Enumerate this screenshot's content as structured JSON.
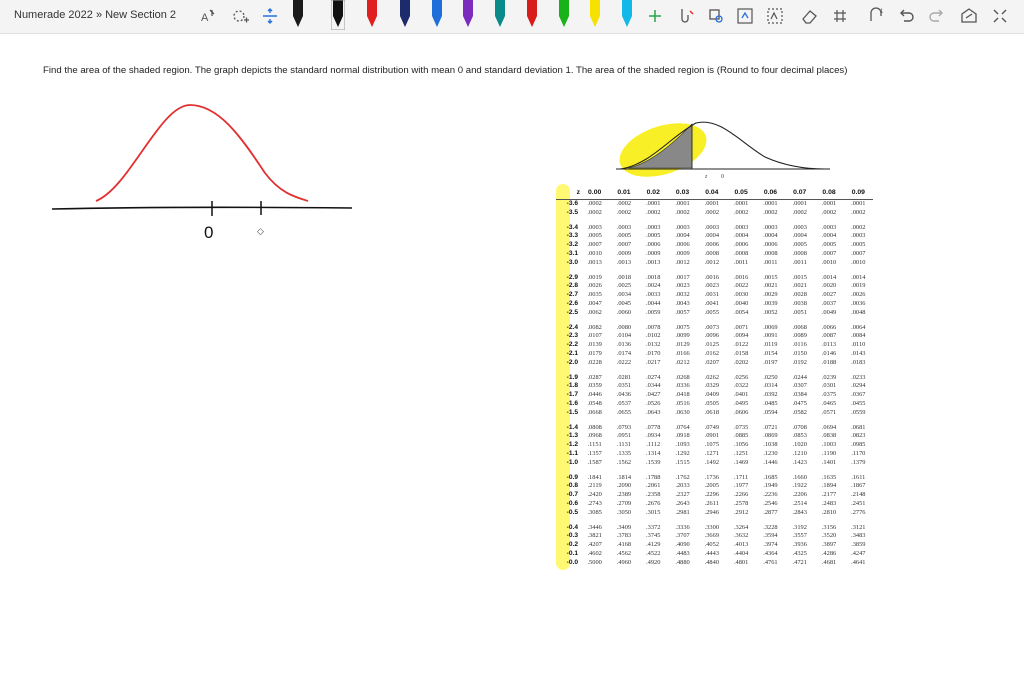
{
  "header": {
    "breadcrumb": "Numerade 2022 » New Section 2"
  },
  "toolbar": {
    "icons": [
      "lasso-select-icon",
      "add-shape-icon",
      "insert-space-icon",
      "pen-black",
      "pen-black-selected",
      "pen-red",
      "pen-navy",
      "pen-blue",
      "pen-purple",
      "pen-teal",
      "pen-red-2",
      "pen-green",
      "pen-yellow-highlighter",
      "pen-cyan",
      "add-pen-icon",
      "ink-to-shape-icon",
      "ink-to-text-icon",
      "ink-replay-icon",
      "math-icon",
      "eraser-icon",
      "ruler-icon",
      "lasso-icon",
      "undo-icon",
      "redo-icon",
      "full-screen-icon",
      "collapse-icon"
    ],
    "pen_colors": [
      "#1a1a1a",
      "#111111",
      "#e02020",
      "#1d2a6b",
      "#1e6fd9",
      "#7b2cbf",
      "#0b8a8a",
      "#d81b1b",
      "#19b219",
      "#f5e200",
      "#12b9e8"
    ]
  },
  "question": {
    "text": "Find the area of the shaded region. The graph depicts the standard normal distribution with mean 0 and standard deviation 1. The area of the shaded region is (Round to four decimal places)"
  },
  "graph": {
    "z_label": "z",
    "zero_label": "0"
  },
  "sketch": {
    "zero_label": "0"
  },
  "ztable": {
    "header": [
      "z",
      "0.00",
      "0.01",
      "0.02",
      "0.03",
      "0.04",
      "0.05",
      "0.06",
      "0.07",
      "0.08",
      "0.09"
    ],
    "groups": [
      [
        [
          "-3.6",
          ".0002",
          ".0002",
          ".0001",
          ".0001",
          ".0001",
          ".0001",
          ".0001",
          ".0001",
          ".0001",
          ".0001"
        ],
        [
          "-3.5",
          ".0002",
          ".0002",
          ".0002",
          ".0002",
          ".0002",
          ".0002",
          ".0002",
          ".0002",
          ".0002",
          ".0002"
        ]
      ],
      [
        [
          "-3.4",
          ".0003",
          ".0003",
          ".0003",
          ".0003",
          ".0003",
          ".0003",
          ".0003",
          ".0003",
          ".0003",
          ".0002"
        ],
        [
          "-3.3",
          ".0005",
          ".0005",
          ".0005",
          ".0004",
          ".0004",
          ".0004",
          ".0004",
          ".0004",
          ".0004",
          ".0003"
        ],
        [
          "-3.2",
          ".0007",
          ".0007",
          ".0006",
          ".0006",
          ".0006",
          ".0006",
          ".0006",
          ".0005",
          ".0005",
          ".0005"
        ],
        [
          "-3.1",
          ".0010",
          ".0009",
          ".0009",
          ".0009",
          ".0008",
          ".0008",
          ".0008",
          ".0008",
          ".0007",
          ".0007"
        ],
        [
          "-3.0",
          ".0013",
          ".0013",
          ".0013",
          ".0012",
          ".0012",
          ".0011",
          ".0011",
          ".0011",
          ".0010",
          ".0010"
        ]
      ],
      [
        [
          "-2.9",
          ".0019",
          ".0018",
          ".0018",
          ".0017",
          ".0016",
          ".0016",
          ".0015",
          ".0015",
          ".0014",
          ".0014"
        ],
        [
          "-2.8",
          ".0026",
          ".0025",
          ".0024",
          ".0023",
          ".0023",
          ".0022",
          ".0021",
          ".0021",
          ".0020",
          ".0019"
        ],
        [
          "-2.7",
          ".0035",
          ".0034",
          ".0033",
          ".0032",
          ".0031",
          ".0030",
          ".0029",
          ".0028",
          ".0027",
          ".0026"
        ],
        [
          "-2.6",
          ".0047",
          ".0045",
          ".0044",
          ".0043",
          ".0041",
          ".0040",
          ".0039",
          ".0038",
          ".0037",
          ".0036"
        ],
        [
          "-2.5",
          ".0062",
          ".0060",
          ".0059",
          ".0057",
          ".0055",
          ".0054",
          ".0052",
          ".0051",
          ".0049",
          ".0048"
        ]
      ],
      [
        [
          "-2.4",
          ".0082",
          ".0080",
          ".0078",
          ".0075",
          ".0073",
          ".0071",
          ".0069",
          ".0068",
          ".0066",
          ".0064"
        ],
        [
          "-2.3",
          ".0107",
          ".0104",
          ".0102",
          ".0099",
          ".0096",
          ".0094",
          ".0091",
          ".0089",
          ".0087",
          ".0084"
        ],
        [
          "-2.2",
          ".0139",
          ".0136",
          ".0132",
          ".0129",
          ".0125",
          ".0122",
          ".0119",
          ".0116",
          ".0113",
          ".0110"
        ],
        [
          "-2.1",
          ".0179",
          ".0174",
          ".0170",
          ".0166",
          ".0162",
          ".0158",
          ".0154",
          ".0150",
          ".0146",
          ".0143"
        ],
        [
          "-2.0",
          ".0228",
          ".0222",
          ".0217",
          ".0212",
          ".0207",
          ".0202",
          ".0197",
          ".0192",
          ".0188",
          ".0183"
        ]
      ],
      [
        [
          "-1.9",
          ".0287",
          ".0281",
          ".0274",
          ".0268",
          ".0262",
          ".0256",
          ".0250",
          ".0244",
          ".0239",
          ".0233"
        ],
        [
          "-1.8",
          ".0359",
          ".0351",
          ".0344",
          ".0336",
          ".0329",
          ".0322",
          ".0314",
          ".0307",
          ".0301",
          ".0294"
        ],
        [
          "-1.7",
          ".0446",
          ".0436",
          ".0427",
          ".0418",
          ".0409",
          ".0401",
          ".0392",
          ".0384",
          ".0375",
          ".0367"
        ],
        [
          "-1.6",
          ".0548",
          ".0537",
          ".0526",
          ".0516",
          ".0505",
          ".0495",
          ".0485",
          ".0475",
          ".0465",
          ".0455"
        ],
        [
          "-1.5",
          ".0668",
          ".0655",
          ".0643",
          ".0630",
          ".0618",
          ".0606",
          ".0594",
          ".0582",
          ".0571",
          ".0559"
        ]
      ],
      [
        [
          "-1.4",
          ".0808",
          ".0793",
          ".0778",
          ".0764",
          ".0749",
          ".0735",
          ".0721",
          ".0708",
          ".0694",
          ".0681"
        ],
        [
          "-1.3",
          ".0968",
          ".0951",
          ".0934",
          ".0918",
          ".0901",
          ".0885",
          ".0869",
          ".0853",
          ".0838",
          ".0823"
        ],
        [
          "-1.2",
          ".1151",
          ".1131",
          ".1112",
          ".1093",
          ".1075",
          ".1056",
          ".1038",
          ".1020",
          ".1003",
          ".0985"
        ],
        [
          "-1.1",
          ".1357",
          ".1335",
          ".1314",
          ".1292",
          ".1271",
          ".1251",
          ".1230",
          ".1210",
          ".1190",
          ".1170"
        ],
        [
          "-1.0",
          ".1587",
          ".1562",
          ".1539",
          ".1515",
          ".1492",
          ".1469",
          ".1446",
          ".1423",
          ".1401",
          ".1379"
        ]
      ],
      [
        [
          "-0.9",
          ".1841",
          ".1814",
          ".1788",
          ".1762",
          ".1736",
          ".1711",
          ".1685",
          ".1660",
          ".1635",
          ".1611"
        ],
        [
          "-0.8",
          ".2119",
          ".2090",
          ".2061",
          ".2033",
          ".2005",
          ".1977",
          ".1949",
          ".1922",
          ".1894",
          ".1867"
        ],
        [
          "-0.7",
          ".2420",
          ".2389",
          ".2358",
          ".2327",
          ".2296",
          ".2266",
          ".2236",
          ".2206",
          ".2177",
          ".2148"
        ],
        [
          "-0.6",
          ".2743",
          ".2709",
          ".2676",
          ".2643",
          ".2611",
          ".2578",
          ".2546",
          ".2514",
          ".2483",
          ".2451"
        ],
        [
          "-0.5",
          ".3085",
          ".3050",
          ".3015",
          ".2981",
          ".2946",
          ".2912",
          ".2877",
          ".2843",
          ".2810",
          ".2776"
        ]
      ],
      [
        [
          "-0.4",
          ".3446",
          ".3409",
          ".3372",
          ".3336",
          ".3300",
          ".3264",
          ".3228",
          ".3192",
          ".3156",
          ".3121"
        ],
        [
          "-0.3",
          ".3821",
          ".3783",
          ".3745",
          ".3707",
          ".3669",
          ".3632",
          ".3594",
          ".3557",
          ".3520",
          ".3483"
        ],
        [
          "-0.2",
          ".4207",
          ".4168",
          ".4129",
          ".4090",
          ".4052",
          ".4013",
          ".3974",
          ".3936",
          ".3897",
          ".3859"
        ],
        [
          "-0.1",
          ".4602",
          ".4562",
          ".4522",
          ".4483",
          ".4443",
          ".4404",
          ".4364",
          ".4325",
          ".4286",
          ".4247"
        ],
        [
          "-0.0",
          ".5000",
          ".4960",
          ".4920",
          ".4880",
          ".4840",
          ".4801",
          ".4761",
          ".4721",
          ".4681",
          ".4641"
        ]
      ]
    ]
  }
}
